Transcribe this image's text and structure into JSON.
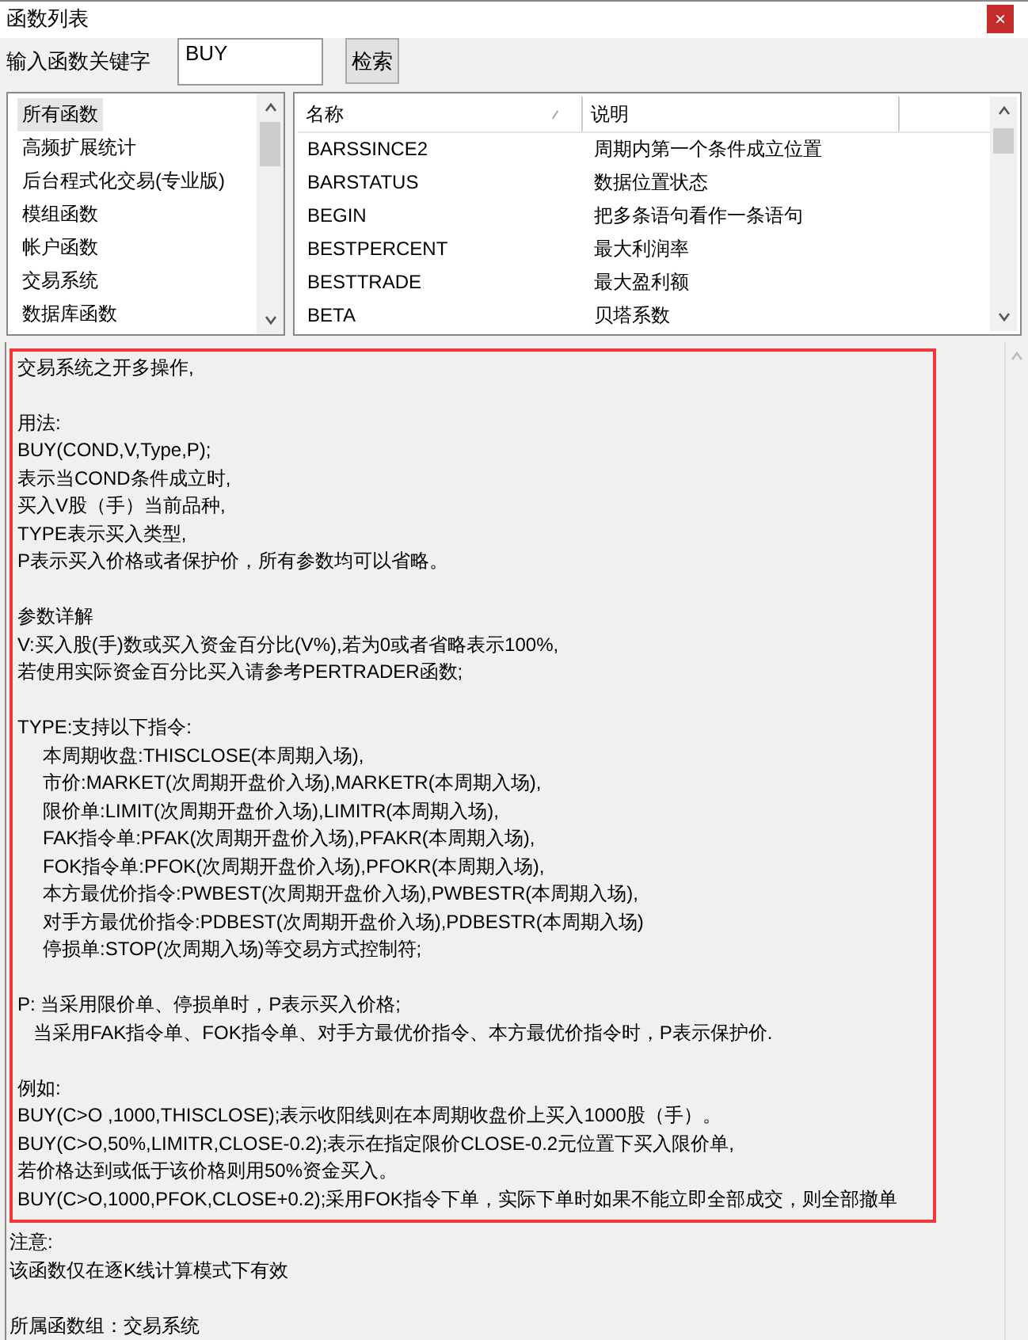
{
  "window": {
    "title": "函数列表",
    "close": "×"
  },
  "search": {
    "label": "输入函数关键字",
    "value": "BUY",
    "button": "检索"
  },
  "categories": [
    {
      "label": "所有函数",
      "selected": true
    },
    {
      "label": "高频扩展统计",
      "selected": false
    },
    {
      "label": "后台程式化交易(专业版)",
      "selected": false
    },
    {
      "label": "模组函数",
      "selected": false
    },
    {
      "label": "帐户函数",
      "selected": false
    },
    {
      "label": "交易系统",
      "selected": false
    },
    {
      "label": "数据库函数",
      "selected": false
    }
  ],
  "table": {
    "columns": [
      "名称",
      "说明"
    ],
    "rows": [
      [
        "BARSSINCE2",
        "周期内第一个条件成立位置"
      ],
      [
        "BARSTATUS",
        "数据位置状态"
      ],
      [
        "BEGIN",
        "把多条语句看作一条语句"
      ],
      [
        "BESTPERCENT",
        "最大利润率"
      ],
      [
        "BESTTRADE",
        "最大盈利额"
      ],
      [
        "BETA",
        "贝塔系数"
      ]
    ]
  },
  "detail": {
    "highlighted_lines": [
      {
        "kind": "plain",
        "text": "交易系统之开多操作,"
      },
      {
        "kind": "blank"
      },
      {
        "kind": "plain",
        "text": "用法:"
      },
      {
        "kind": "plain",
        "text": "BUY(COND,V,Type,P);"
      },
      {
        "kind": "plain",
        "text": "表示当COND条件成立时,"
      },
      {
        "kind": "plain",
        "text": "买入V股（手）当前品种,"
      },
      {
        "kind": "plain",
        "text": "TYPE表示买入类型,"
      },
      {
        "kind": "plain",
        "text": "P表示买入价格或者保护价，所有参数均可以省略。"
      },
      {
        "kind": "blank"
      },
      {
        "kind": "plain",
        "text": "参数详解"
      },
      {
        "kind": "plain",
        "text": "V:买入股(手)数或买入资金百分比(V%),若为0或者省略表示100%,"
      },
      {
        "kind": "plain",
        "text": "若使用实际资金百分比买入请参考PERTRADER函数;"
      },
      {
        "kind": "blank"
      },
      {
        "kind": "plain",
        "text": "TYPE:支持以下指令:"
      },
      {
        "kind": "indented",
        "text": "本周期收盘:THISCLOSE(本周期入场),"
      },
      {
        "kind": "indented",
        "text": "市价:MARKET(次周期开盘价入场),MARKETR(本周期入场),"
      },
      {
        "kind": "indented",
        "text": "限价单:LIMIT(次周期开盘价入场),LIMITR(本周期入场),"
      },
      {
        "kind": "indented",
        "text": "FAK指令单:PFAK(次周期开盘价入场),PFAKR(本周期入场),"
      },
      {
        "kind": "indented",
        "text": "FOK指令单:PFOK(次周期开盘价入场),PFOKR(本周期入场),"
      },
      {
        "kind": "indented",
        "text": "本方最优价指令:PWBEST(次周期开盘价入场),PWBESTR(本周期入场),"
      },
      {
        "kind": "indented",
        "text": "对手方最优价指令:PDBEST(次周期开盘价入场),PDBESTR(本周期入场)"
      },
      {
        "kind": "indented",
        "text": "停损单:STOP(次周期入场)等交易方式控制符;"
      },
      {
        "kind": "blank"
      },
      {
        "kind": "plain",
        "text": "P: 当采用限价单、停损单时，P表示买入价格;"
      },
      {
        "kind": "half",
        "text": "当采用FAK指令单、FOK指令单、对手方最优价指令、本方最优价指令时，P表示保护价."
      },
      {
        "kind": "blank"
      },
      {
        "kind": "plain",
        "text": "例如:"
      },
      {
        "kind": "plain",
        "text": "BUY(C>O ,1000,THISCLOSE);表示收阳线则在本周期收盘价上买入1000股（手）。"
      },
      {
        "kind": "plain",
        "text": "BUY(C>O,50%,LIMITR,CLOSE-0.2);表示在指定限价CLOSE-0.2元位置下买入限价单,"
      },
      {
        "kind": "plain",
        "text": "若价格达到或低于该价格则用50%资金买入。"
      },
      {
        "kind": "plain",
        "text": "BUY(C>O,1000,PFOK,CLOSE+0.2);采用FOK指令下单，实际下单时如果不能立即全部成交，则全部撤单"
      }
    ],
    "lines": [
      {
        "kind": "plain",
        "text": "注意:"
      },
      {
        "kind": "plain",
        "text": "该函数仅在逐K线计算模式下有效"
      },
      {
        "kind": "blank"
      },
      {
        "kind": "plain",
        "text": "所属函数组：交易系统"
      }
    ]
  }
}
